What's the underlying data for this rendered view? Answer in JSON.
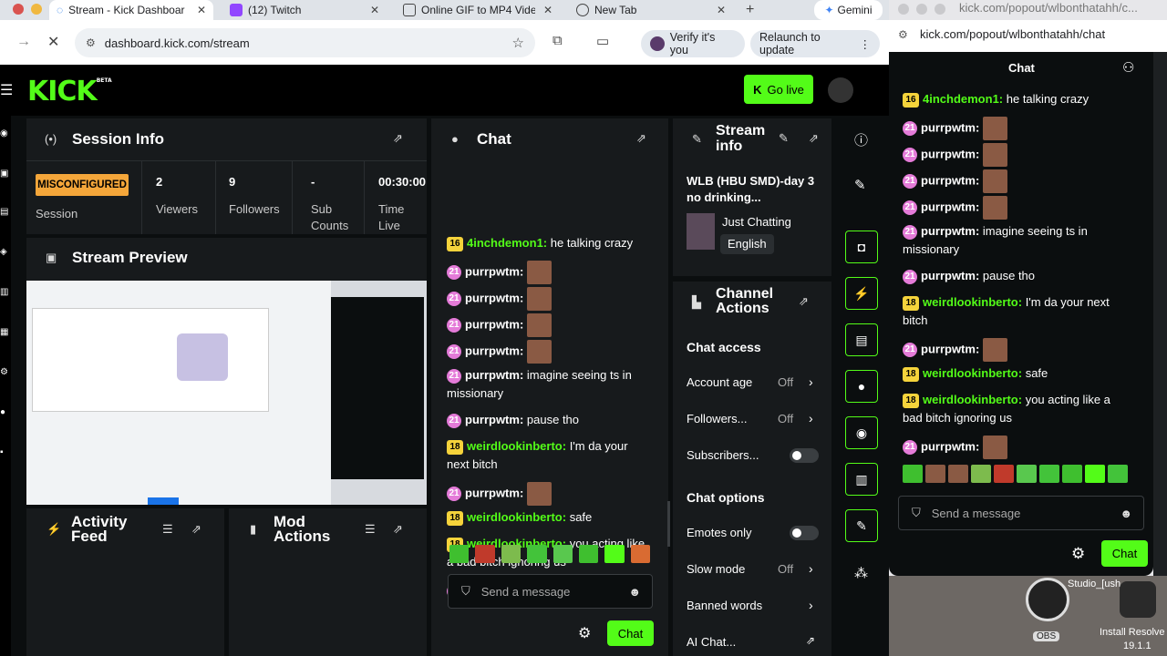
{
  "browser": {
    "tabs": [
      {
        "label": "Stream - Kick Dashboar",
        "active": true
      },
      {
        "label": "(12) Twitch"
      },
      {
        "label": "Online GIF to MP4 Video"
      },
      {
        "label": "New Tab"
      }
    ],
    "gemini_label": "Gemini",
    "url": "dashboard.kick.com/stream",
    "verify_label": "Verify it's you",
    "relaunch_label": "Relaunch to update"
  },
  "popout_window": {
    "title_url": "kick.com/popout/wlbonthatahh/c...",
    "url": "kick.com/popout/wlbonthatahh/chat",
    "chat_title": "Chat",
    "input_placeholder": "Send a message",
    "send_label": "Chat"
  },
  "dashboard": {
    "go_live_label": "Go live",
    "session_info": {
      "title": "Session Info",
      "status_badge": "MISCONFIGURED",
      "status_label": "Session",
      "stats": [
        {
          "value": "2",
          "label": "Viewers"
        },
        {
          "value": "9",
          "label": "Followers"
        },
        {
          "value": "-",
          "label": "Sub Counts"
        },
        {
          "value": "00:30:00",
          "label": "Time Live"
        }
      ]
    },
    "stream_preview": {
      "title": "Stream Preview"
    },
    "activity_feed": {
      "title": "Activity Feed"
    },
    "mod_actions": {
      "title": "Mod Actions"
    },
    "chat": {
      "title": "Chat",
      "input_placeholder": "Send a message",
      "send_label": "Chat"
    },
    "stream_info": {
      "title": "Stream info",
      "stream_title": "WLB (HBU SMD)-day 3 no drinking...",
      "category": "Just Chatting",
      "language": "English"
    },
    "channel_actions": {
      "title": "Channel Actions",
      "chat_access_heading": "Chat access",
      "account_age": {
        "label": "Account age",
        "value": "Off"
      },
      "followers": {
        "label": "Followers...",
        "value": "Off"
      },
      "subscribers": {
        "label": "Subscribers..."
      },
      "chat_options_heading": "Chat options",
      "emotes_only": {
        "label": "Emotes only"
      },
      "slow_mode": {
        "label": "Slow mode",
        "value": "Off"
      },
      "banned_words": {
        "label": "Banned words"
      },
      "ai_chat": {
        "label": "AI Chat..."
      }
    }
  },
  "chat_messages": [
    {
      "badge": "16",
      "user": "4inchdemon1:",
      "text": "he talking crazy"
    },
    {
      "badge": "21",
      "user": "purrpwtm:",
      "emote": true
    },
    {
      "badge": "21",
      "user": "purrpwtm:",
      "emote": true
    },
    {
      "badge": "21",
      "user": "purrpwtm:",
      "emote": true
    },
    {
      "badge": "21",
      "user": "purrpwtm:",
      "emote": true
    },
    {
      "badge": "21",
      "user": "purrpwtm:",
      "text": "imagine seeing ts in missionary"
    },
    {
      "badge": "21",
      "user": "purrpwtm:",
      "text": "pause tho"
    },
    {
      "badge": "18",
      "user": "weirdlookinberto:",
      "text": "I'm da your next bitch"
    },
    {
      "badge": "21",
      "user": "purrpwtm:",
      "emote": true
    },
    {
      "badge": "18",
      "user": "weirdlookinberto:",
      "text": "safe"
    },
    {
      "badge": "18",
      "user": "weirdlookinberto:",
      "text": "you acting like a bad bitch ignoring us"
    },
    {
      "badge": "21",
      "user": "purrpwtm:",
      "emote": true
    }
  ],
  "taskbar": {
    "obs_label": "OBS",
    "studio_label": "Studio_[ush",
    "install_label": "Install Resolve",
    "version_label": "19.1.1"
  },
  "colors": {
    "accent": "#53fc18",
    "panel": "#171a1c",
    "background": "#0b0e0f",
    "warning": "#f4a63a"
  }
}
